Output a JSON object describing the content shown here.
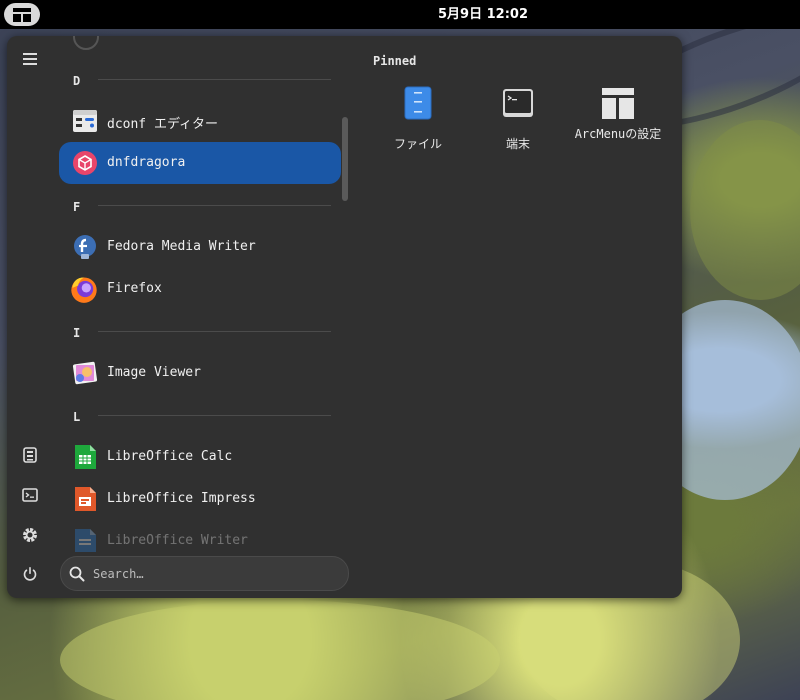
{
  "topbar": {
    "clock": "5月9日 12:02",
    "menu_button_icon": "arcmenu-layout-icon"
  },
  "sidebar": {
    "icons": [
      "hamburger-icon",
      "file-manager-icon",
      "terminal-icon",
      "settings-icon",
      "power-icon"
    ]
  },
  "app_list": {
    "sections": [
      {
        "letter": "D"
      },
      {
        "letter": "F"
      },
      {
        "letter": "I"
      },
      {
        "letter": "L"
      }
    ],
    "apps": [
      {
        "label": "dconf エディター",
        "icon": "dconf-editor-icon"
      },
      {
        "label": "dnfdragora",
        "icon": "dnfdragora-icon",
        "selected": true
      },
      {
        "label": "Fedora Media Writer",
        "icon": "fedora-media-writer-icon"
      },
      {
        "label": "Firefox",
        "icon": "firefox-icon"
      },
      {
        "label": "Image Viewer",
        "icon": "image-viewer-icon"
      },
      {
        "label": "LibreOffice Calc",
        "icon": "libreoffice-calc-icon"
      },
      {
        "label": "LibreOffice Impress",
        "icon": "libreoffice-impress-icon"
      },
      {
        "label": "LibreOffice Writer",
        "icon": "libreoffice-writer-icon"
      }
    ]
  },
  "search": {
    "placeholder": "Search…"
  },
  "pinned": {
    "title": "Pinned",
    "items": [
      {
        "label": "ファイル",
        "icon": "files-icon"
      },
      {
        "label": "端末",
        "icon": "terminal-icon"
      },
      {
        "label": "ArcMenuの設定",
        "icon": "arcmenu-settings-icon"
      }
    ]
  },
  "colors": {
    "selection": "#1a57a6",
    "menu_bg": "#303030",
    "topbar_bg": "#000000"
  }
}
